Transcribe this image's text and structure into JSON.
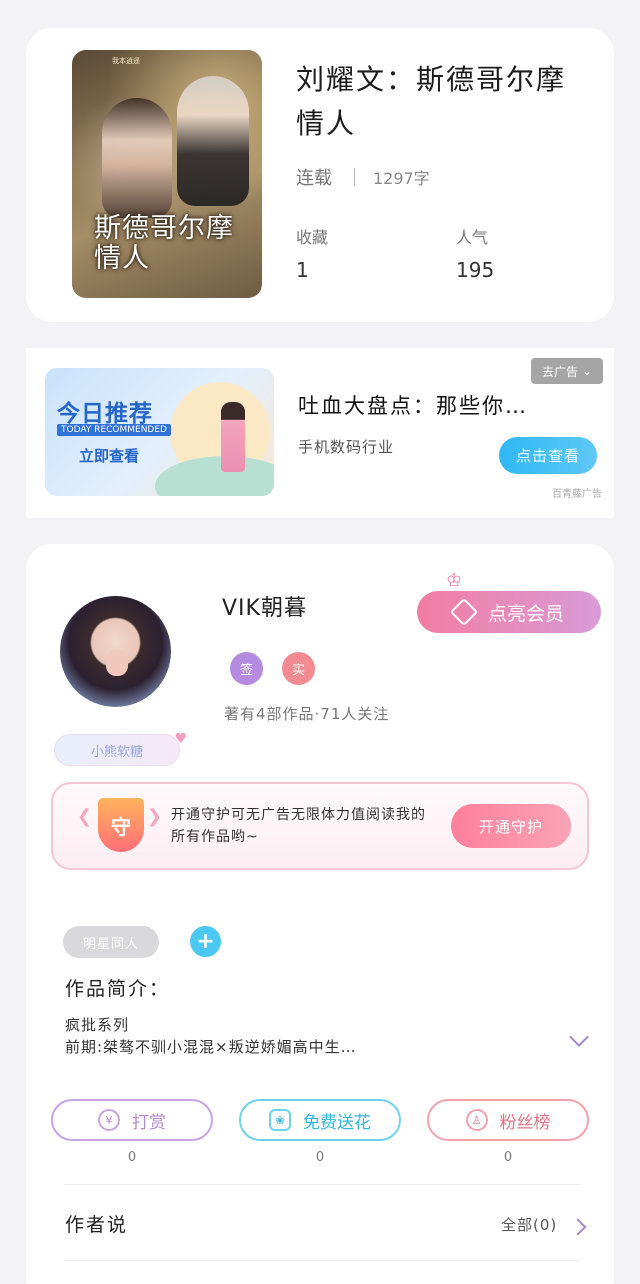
{
  "book": {
    "cover_tag": "我本逍遥",
    "cover_title": "斯德哥尔摩情人",
    "title": "刘耀文：斯德哥尔摩情人",
    "status": "连载",
    "word_count": "1297字",
    "collect_label": "收藏",
    "collect_value": "1",
    "popularity_label": "人气",
    "popularity_value": "195"
  },
  "ad": {
    "close_label": "去广告",
    "banner_title": "今日推荐",
    "banner_subtitle": "TODAY RECOMMENDED",
    "banner_cta": "立即查看",
    "title": "吐血大盘点：那些你…",
    "subtitle": "手机数码行业",
    "button": "点击查看",
    "source": "百青藤广告"
  },
  "author": {
    "name": "VIK朝暮",
    "vip_button": "点亮会员",
    "badge_sign": "签",
    "badge_real": "实",
    "works_info": "著有4部作品·71人关注",
    "fan_tag": "小熊软糖",
    "guard_icon": "守",
    "guard_text": "开通守护可无广告无限体力值阅读我的所有作品哟~",
    "guard_button": "开通守护",
    "tag_chip": "明星同人",
    "intro_label": "作品简介：",
    "intro_line1": "疯批系列",
    "intro_line2": "前期:桀骜不驯小混混×叛逆娇媚高中生…",
    "actions": [
      {
        "label": "打赏",
        "icon": "¥",
        "count": "0",
        "color": "#b38ad6"
      },
      {
        "label": "免费送花",
        "icon": "❀",
        "count": "0",
        "color": "#3cc3e6"
      },
      {
        "label": "粉丝榜",
        "icon": "♙",
        "count": "0",
        "color": "#ea7a8c"
      }
    ],
    "say_label": "作者说",
    "say_all": "全部(0)"
  }
}
